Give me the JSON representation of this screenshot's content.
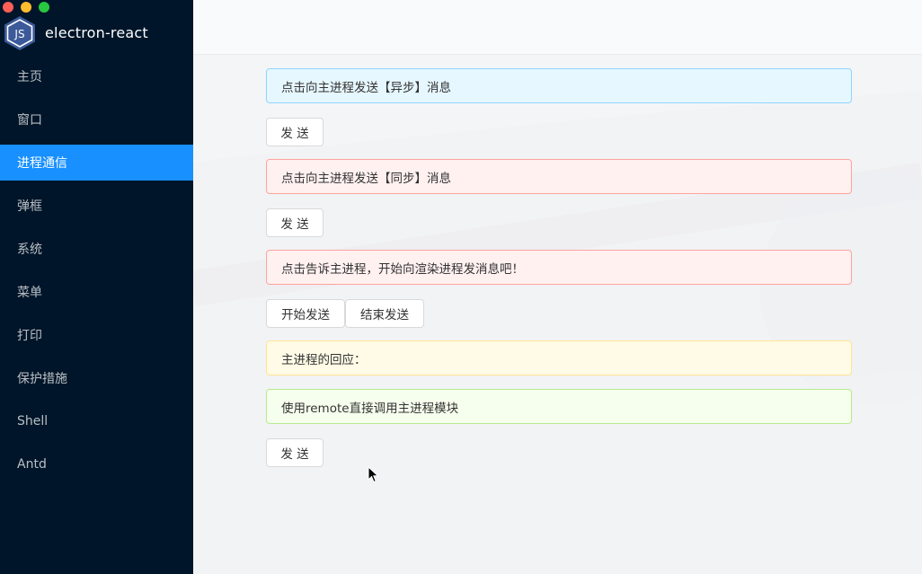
{
  "app": {
    "title": "electron-react",
    "logo_text": "JS",
    "colors": {
      "sidebar_bg": "#001529",
      "active_item": "#1890ff",
      "traffic_red": "#ff5f57",
      "traffic_yellow": "#febc2e",
      "traffic_green": "#28c840"
    }
  },
  "sidebar": {
    "items": [
      {
        "label": "主页",
        "active": false
      },
      {
        "label": "窗口",
        "active": false
      },
      {
        "label": "进程通信",
        "active": true
      },
      {
        "label": "弹框",
        "active": false
      },
      {
        "label": "系统",
        "active": false
      },
      {
        "label": "菜单",
        "active": false
      },
      {
        "label": "打印",
        "active": false
      },
      {
        "label": "保护措施",
        "active": false
      },
      {
        "label": "Shell",
        "active": false
      },
      {
        "label": "Antd",
        "active": false
      }
    ]
  },
  "main": {
    "async_alert": "点击向主进程发送【异步】消息",
    "async_send_label": "发 送",
    "sync_alert": "点击向主进程发送【同步】消息",
    "sync_send_label": "发 送",
    "renderer_alert": "点击告诉主进程，开始向渲染进程发消息吧！",
    "start_send_label": "开始发送",
    "stop_send_label": "结束发送",
    "reply_alert": "主进程的回应：",
    "remote_alert": "使用remote直接调用主进程模块",
    "remote_send_label": "发 送"
  }
}
